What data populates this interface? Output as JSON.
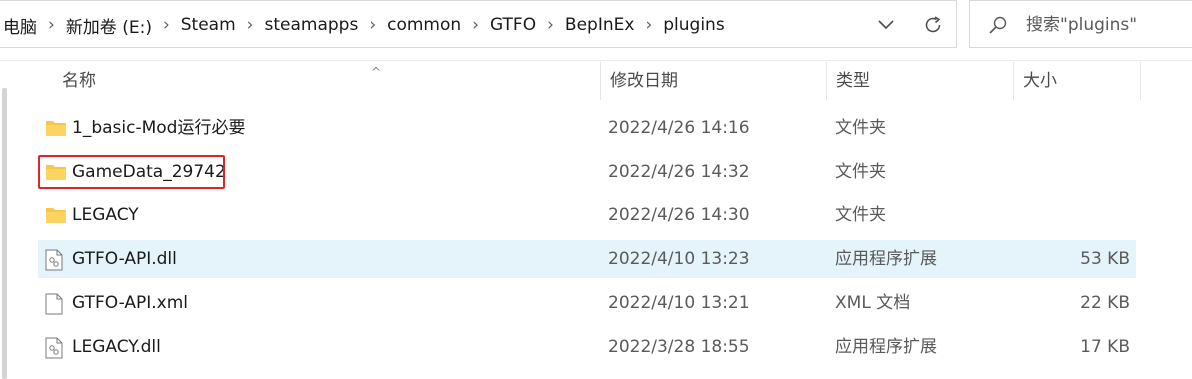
{
  "address_bar": {
    "breadcrumbs": [
      "电脑",
      "新加卷 (E:)",
      "Steam",
      "steamapps",
      "common",
      "GTFO",
      "BepInEx",
      "plugins"
    ],
    "separator": "›",
    "dropdown_icon": "chevron-down-icon",
    "refresh_icon": "refresh-icon"
  },
  "search": {
    "placeholder": "搜索\"plugins\"",
    "icon": "search-icon"
  },
  "columns": {
    "name": "名称",
    "date": "修改日期",
    "type": "类型",
    "size": "大小",
    "sorted_by": "name"
  },
  "files": [
    {
      "name": "1_basic-Mod运行必要",
      "date": "2022/4/26 14:16",
      "type": "文件夹",
      "size": "",
      "icon": "folder-icon"
    },
    {
      "name": "GameData_29742",
      "date": "2022/4/26 14:32",
      "type": "文件夹",
      "size": "",
      "icon": "folder-icon",
      "highlighted": true
    },
    {
      "name": "LEGACY",
      "date": "2022/4/26 14:30",
      "type": "文件夹",
      "size": "",
      "icon": "folder-icon"
    },
    {
      "name": "GTFO-API.dll",
      "date": "2022/4/10 13:23",
      "type": "应用程序扩展",
      "size": "53 KB",
      "icon": "dll-icon",
      "hovered": true
    },
    {
      "name": "GTFO-API.xml",
      "date": "2022/4/10 13:21",
      "type": "XML 文档",
      "size": "22 KB",
      "icon": "file-icon"
    },
    {
      "name": "LEGACY.dll",
      "date": "2022/3/28 18:55",
      "type": "应用程序扩展",
      "size": "17 KB",
      "icon": "dll-icon"
    }
  ],
  "colors": {
    "hover_row": "#e5f3fb",
    "highlight_box": "#e0242a",
    "folder": "#f8c74a"
  }
}
